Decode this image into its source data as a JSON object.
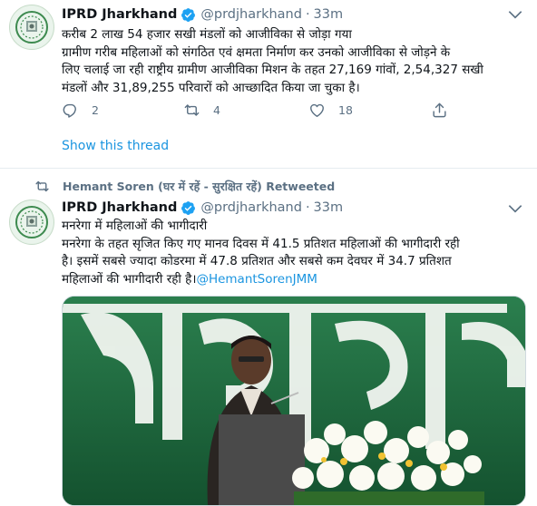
{
  "tweet1": {
    "author_name": "IPRD Jharkhand",
    "handle": "@prdjharkhand",
    "separator": "·",
    "time": "33m",
    "lines": [
      "करीब 2 लाख 54 हजार सखी मंडलों को आजीविका से जोड़ा गया",
      "ग्रामीण गरीब महिलाओं को संगठित एवं क्षमता निर्माण कर उनको आजीविका से जोड़ने के",
      "लिए चलाई जा रही राष्ट्रीय ग्रामीण आजीविका मिशन के तहत 27,169 गांवों, 2,54,327 सखी",
      "मंडलों और 31,89,255 परिवारों को आच्छादित किया जा चुका है।"
    ],
    "replies": "2",
    "retweets": "4",
    "likes": "18",
    "show_thread": "Show this thread"
  },
  "tweet2": {
    "retweeted_by": "Hemant Soren (घर में रहें - सुरक्षित रहें) Retweeted",
    "author_name": "IPRD Jharkhand",
    "handle": "@prdjharkhand",
    "separator": "·",
    "time": "33m",
    "lines": [
      "मनरेगा में महिलाओं की भागीदारी",
      "मनरेगा के तहत सृजित किए गए मानव दिवस में 41.5 प्रतिशत महिलाओं की भागीदारी रही",
      "है। इसमें सबसे ज्यादा कोडरमा में 47.8 प्रतिशत और सबसे कम देवघर में 34.7 प्रतिशत",
      "महिलाओं की भागीदारी रही है।"
    ],
    "mention": "@HemantSorenJMM"
  },
  "icons": [
    "verified-badge-icon",
    "more-options-icon",
    "reply-icon",
    "retweet-icon",
    "like-icon",
    "share-icon"
  ],
  "colors": {
    "accent": "#1b95e0",
    "muted": "#5b7083",
    "verified": "#1da1f2",
    "text": "#0f1419"
  }
}
